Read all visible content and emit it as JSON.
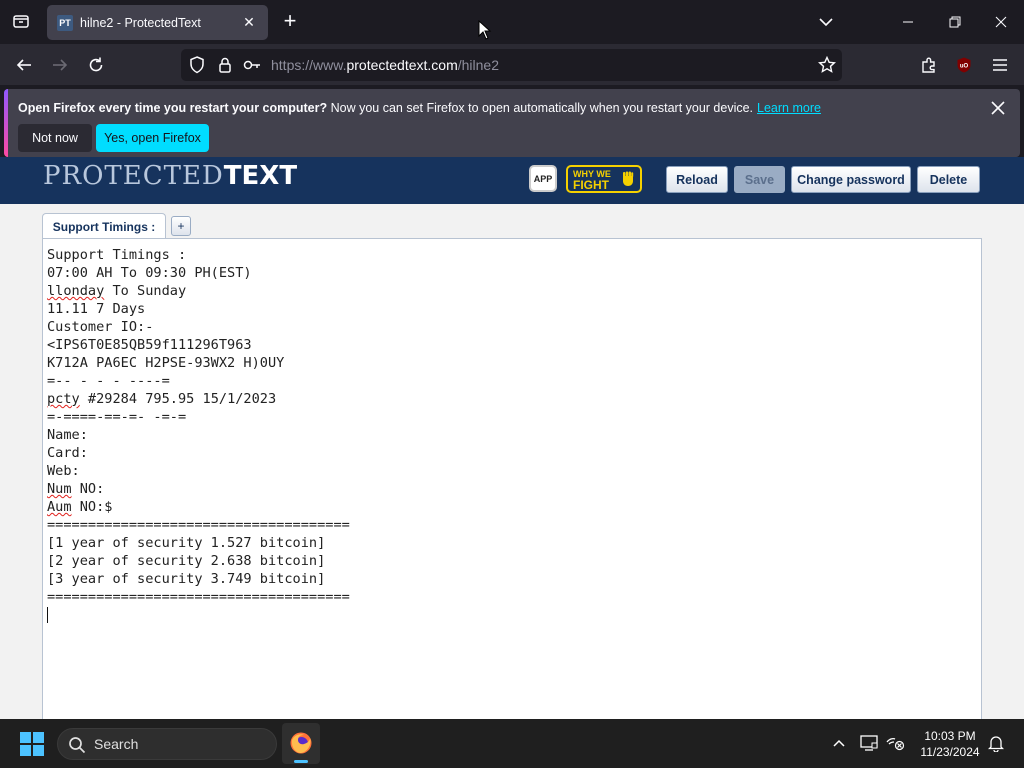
{
  "browser": {
    "tab_title": "hilne2 - ProtectedText",
    "tab_favicon": "PT",
    "url_prefix": "https://www.",
    "url_host": "protectedtext.com",
    "url_path": "/hilne2"
  },
  "notification": {
    "bold_text": "Open Firefox every time you restart your computer?",
    "text": " Now you can set Firefox to open automatically when you restart your device.",
    "link": "Learn more",
    "not_now": "Not now",
    "yes": "Yes, open Firefox"
  },
  "site": {
    "logo_light": "PROTECTED",
    "logo_bold": "TEXT",
    "app_badge": "APP",
    "fight_line1": "WHY WE",
    "fight_line2": "FIGHT",
    "buttons": {
      "reload": "Reload",
      "save": "Save",
      "change_password": "Change password",
      "delete": "Delete"
    },
    "note_tab": "Support Timings :",
    "add_tab": "+"
  },
  "note": {
    "lines": [
      "Support Timings :",
      "07:00 AH To 09:30 PH(EST)",
      "llonday To Sunday",
      "11.11 7 Days",
      "Customer IO:-",
      "<IPS6T0E85QB59f111296T963",
      "K712A PA6EC H2PSE-93WX2 H)0UY",
      "=-- - - - ----=",
      "pcty #29284 795.95 15/1/2023",
      "=-====-==-=- -=-=",
      "Name:",
      "Card:",
      "Web:",
      "Num NO:",
      "Aum NO:$",
      "=====================================",
      "[1 year of security 1.527 bitcoin]",
      "[2 year of security 2.638 bitcoin]",
      "[3 year of security 3.749 bitcoin]",
      "====================================="
    ],
    "misspelled": {
      "l2": "llonday",
      "l2_rest": " To Sunday",
      "l8": "pcty",
      "l8_rest": " #29284 795.95 15/1/2023",
      "l13": "Num",
      "l13_rest": " NO:",
      "l14": "Aum",
      "l14_rest": " NO:$"
    }
  },
  "taskbar": {
    "search_label": "Search",
    "time": "10:03 PM",
    "date": "11/23/2024"
  },
  "colors": {
    "header_bg": "#16335d",
    "notif_button": "#00ddff",
    "browser_bg": "#1c1b22"
  }
}
